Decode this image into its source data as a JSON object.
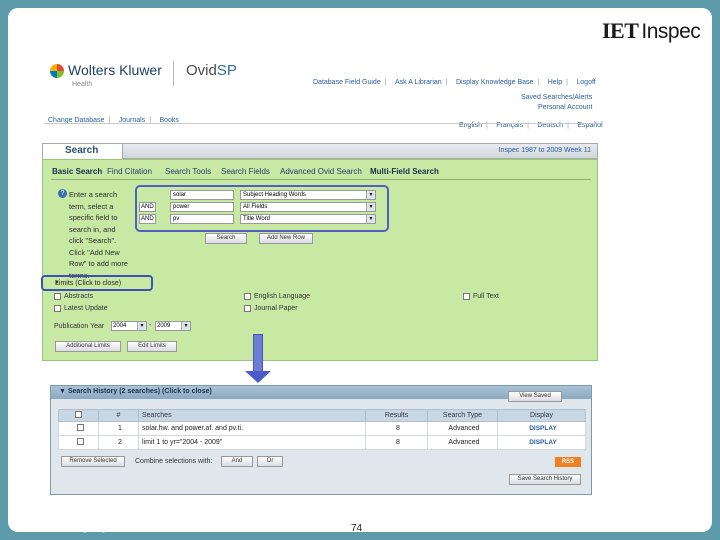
{
  "brand": {
    "iet_prefix": "IET",
    "iet_name": "Inspec",
    "wk_name": "Wolters Kluwer",
    "wk_sub": "Health",
    "ovid_a": "Ovid",
    "ovid_b": "SP"
  },
  "toplinks": [
    "Database Field Guide",
    "Ask A Librarian",
    "Display Knowledge Base",
    "Help",
    "Logoff"
  ],
  "rightlinks": {
    "saved": "Saved Searches/Alerts",
    "account": "Personal Account"
  },
  "languages": [
    "English",
    "Français",
    "Deutsch",
    "Español"
  ],
  "leftlinks": [
    "Change Database",
    "Journals",
    "Books"
  ],
  "search": {
    "tab": "Search",
    "db_info": "Inspec 1987 to 2009 Week 11",
    "tabs": [
      "Basic Search",
      "Find Citation",
      "Search Tools",
      "Search Fields",
      "Advanced Ovid Search",
      "Multi-Field Search"
    ],
    "help_text": "Enter a search term, select a specific field to search in, and click \"Search\". Click \"Add New Row\" to add more terms.",
    "rows": [
      {
        "bool": "",
        "term": "solar",
        "field": "Subject Heading Words"
      },
      {
        "bool": "AND",
        "term": "power",
        "field": "All Fields"
      },
      {
        "bool": "AND",
        "term": "pv",
        "field": "Title Word"
      }
    ],
    "search_btn": "Search",
    "add_row_btn": "Add New Row"
  },
  "limits": {
    "label": "Limits (Click to close)",
    "items": [
      "Abstracts",
      "English Language",
      "Full Text",
      "Latest Update",
      "Journal Paper"
    ],
    "pubyear_label": "Publication Year",
    "from": "2004",
    "to": "2009",
    "add_btn": "Additional Limits",
    "edit_btn": "Edit Limits"
  },
  "history": {
    "title": "Search History (2 searches) (Click to close)",
    "view_saved": "View Saved",
    "headers": [
      "#",
      "Searches",
      "Results",
      "Search Type",
      "Display"
    ],
    "rows": [
      {
        "num": "1",
        "search": "solar.hw. and power.af. and pv.ti.",
        "results": "8",
        "type": "Advanced",
        "display": "DISPLAY"
      },
      {
        "num": "2",
        "search": "limit 1 to yr=\"2004 - 2009\"",
        "results": "8",
        "type": "Advanced",
        "display": "DISPLAY"
      }
    ],
    "remove_btn": "Remove Selected",
    "combine_label": "Combine selections with:",
    "and_btn": "And",
    "or_btn": "Or",
    "rss": "RSS",
    "save_btn": "Save Search History"
  },
  "footer": {
    "url": "www.theiet.org/Inspec",
    "page": "74"
  }
}
